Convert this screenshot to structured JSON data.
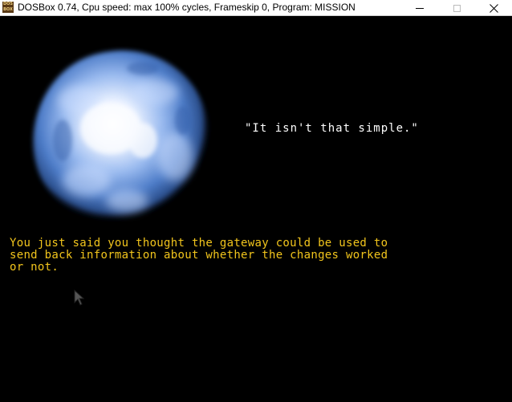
{
  "window": {
    "icon_text": "DOS BOX",
    "title": "DOSBox 0.74, Cpu speed: max 100% cycles, Frameskip  0, Program:  MISSION"
  },
  "game": {
    "quote": "\"It isn't that simple.\"",
    "narration_lines": [
      "You just said you thought the gateway could be used to",
      "send back information about whether the changes worked",
      "or not."
    ],
    "narration_color": "#f2c51c",
    "quote_color": "#ffffff",
    "orb_color": "#5a8ad8"
  }
}
